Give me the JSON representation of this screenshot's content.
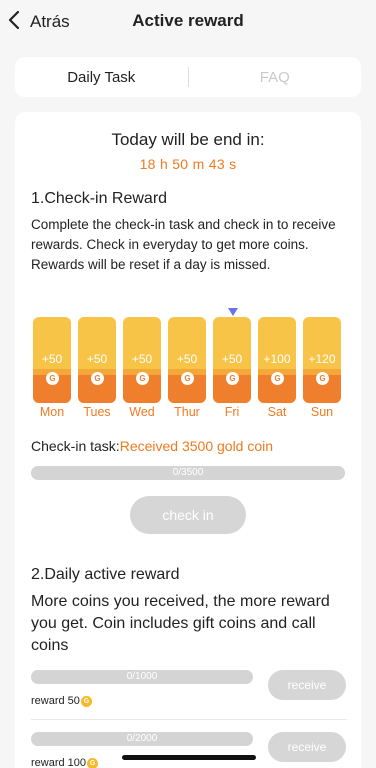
{
  "header": {
    "back_label": "Atrás",
    "title": "Active reward"
  },
  "tabs": [
    {
      "label": "Daily Task",
      "active": true
    },
    {
      "label": "FAQ",
      "active": false
    }
  ],
  "countdown": {
    "label": "Today will be end in:",
    "value": "18 h 50 m 43 s"
  },
  "checkin": {
    "title": "1.Check-in Reward",
    "description": "Complete the check-in task and check in to receive rewards.  Check in everyday to get more coins. Rewards will be reset if a day is missed.",
    "days": [
      {
        "name": "Mon",
        "amount": "+50"
      },
      {
        "name": "Tues",
        "amount": "+50"
      },
      {
        "name": "Wed",
        "amount": "+50"
      },
      {
        "name": "Thur",
        "amount": "+50"
      },
      {
        "name": "Fri",
        "amount": "+50"
      },
      {
        "name": "Sat",
        "amount": "+100"
      },
      {
        "name": "Sun",
        "amount": "+120"
      }
    ],
    "current_day": "Fri",
    "coin_glyph": "G",
    "task_label": "Check-in task:",
    "task_value": "Received 3500 gold coin",
    "progress_text": "0/3500",
    "progress": 0,
    "button_label": "check in"
  },
  "daily": {
    "title": "2.Daily active reward",
    "description": "More coins you received, the more reward you get. Coin includes gift coins and call coins",
    "rows": [
      {
        "progress_text": "0/1000",
        "progress": 0,
        "reward_label": "reward 50",
        "button_label": "receive"
      },
      {
        "progress_text": "0/2000",
        "progress": 0,
        "reward_label": "reward 100",
        "button_label": "receive"
      }
    ]
  },
  "colors": {
    "accent": "#f07a22",
    "gold": "#f7c448",
    "marker": "#6b73e8",
    "disabled": "#d6d6d6"
  }
}
